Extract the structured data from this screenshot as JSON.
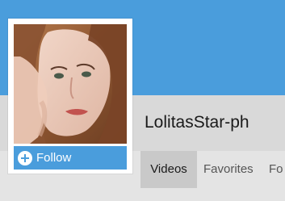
{
  "profile": {
    "username": "LolitasStar-ph",
    "follow_label": "Follow"
  },
  "tabs": [
    {
      "label": "Videos",
      "active": true
    },
    {
      "label": "Favorites",
      "active": false
    },
    {
      "label": "Fo",
      "active": false
    }
  ],
  "colors": {
    "banner": "#4a9ddc",
    "follow_button": "#4a9ddc",
    "band": "#d9d9d9",
    "active_tab": "#c9c9c9"
  },
  "icons": {
    "follow": "plus-circle-icon"
  }
}
